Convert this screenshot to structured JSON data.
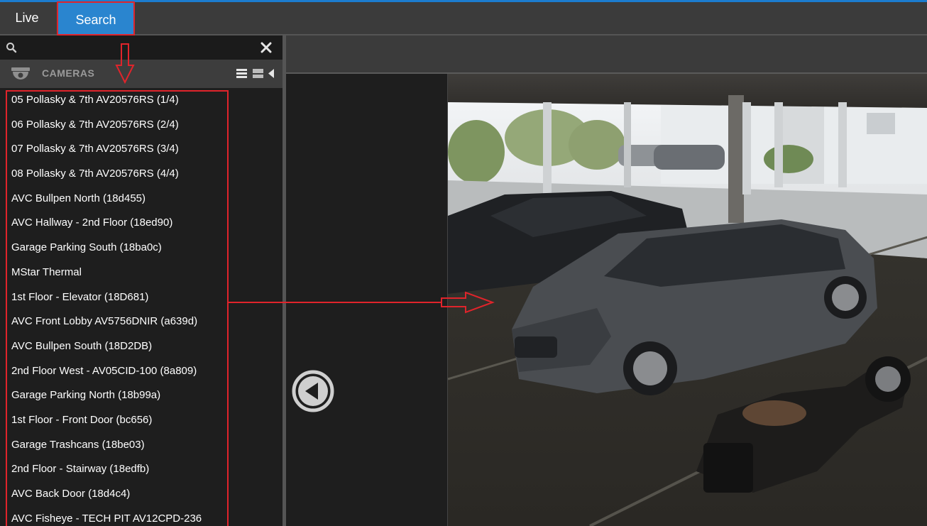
{
  "tabs": {
    "live_label": "Live",
    "search_label": "Search"
  },
  "sidebar": {
    "search": {
      "placeholder": "",
      "value": ""
    },
    "header_title": "CAMERAS",
    "cameras": [
      "05 Pollasky & 7th AV20576RS (1/4)",
      "06 Pollasky & 7th AV20576RS (2/4)",
      "07 Pollasky & 7th AV20576RS (3/4)",
      "08 Pollasky & 7th AV20576RS (4/4)",
      "AVC Bullpen North (18d455)",
      "AVC Hallway - 2nd Floor (18ed90)",
      "Garage Parking South (18ba0c)",
      "MStar Thermal",
      "1st Floor - Elevator (18D681)",
      "AVC Front Lobby AV5756DNIR (a639d)",
      "AVC Bullpen South (18D2DB)",
      "2nd Floor West - AV05CID-100 (8a809)",
      "Garage Parking North (18b99a)",
      "1st Floor - Front Door (bc656)",
      "Garage Trashcans (18be03)",
      "2nd Floor - Stairway (18edfb)",
      "AVC Back Door (18d4c4)",
      "AVC Fisheye - TECH PIT AV12CPD-236"
    ]
  },
  "icons": {
    "search": "search-icon",
    "clear": "close-icon",
    "camera": "dome-camera-icon",
    "list_view": "list-view-icon",
    "grid_view": "grid-view-icon",
    "collapse": "chevron-left-icon",
    "prev": "previous-circle-icon"
  },
  "colors": {
    "accent": "#2a85cf",
    "annotation": "#e0242b",
    "panel": "#1e1e1e",
    "bar": "#3b3b3b"
  }
}
